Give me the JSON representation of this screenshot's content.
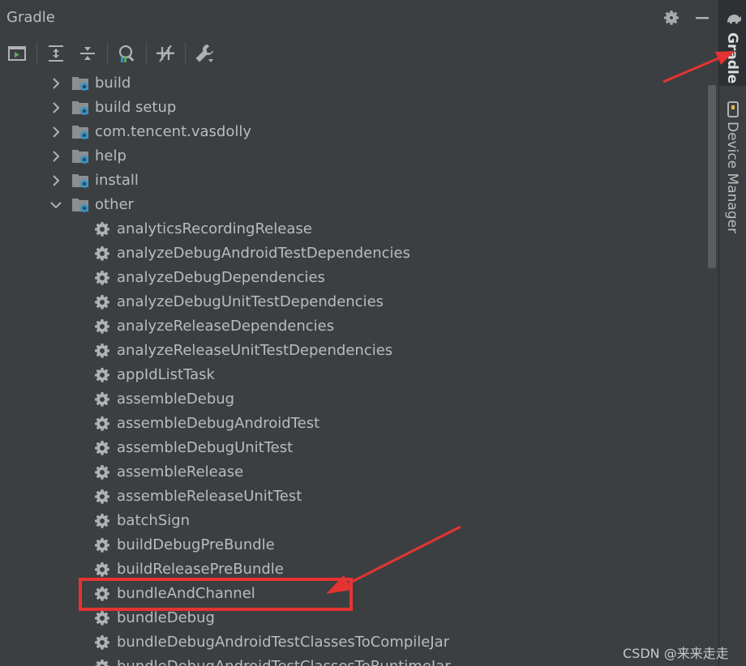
{
  "panel": {
    "title": "Gradle"
  },
  "tree": {
    "groups": [
      {
        "label": "build",
        "expanded": false
      },
      {
        "label": "build setup",
        "expanded": false
      },
      {
        "label": "com.tencent.vasdolly",
        "expanded": false
      },
      {
        "label": "help",
        "expanded": false
      },
      {
        "label": "install",
        "expanded": false
      },
      {
        "label": "other",
        "expanded": true
      }
    ],
    "tasks": [
      "analyticsRecordingRelease",
      "analyzeDebugAndroidTestDependencies",
      "analyzeDebugDependencies",
      "analyzeDebugUnitTestDependencies",
      "analyzeReleaseDependencies",
      "analyzeReleaseUnitTestDependencies",
      "appIdListTask",
      "assembleDebug",
      "assembleDebugAndroidTest",
      "assembleDebugUnitTest",
      "assembleRelease",
      "assembleReleaseUnitTest",
      "batchSign",
      "buildDebugPreBundle",
      "buildReleasePreBundle",
      "bundleAndChannel",
      "bundleDebug",
      "bundleDebugAndroidTestClassesToCompileJar",
      "bundleDebugAndroidTestClassesToRuntimeJar"
    ]
  },
  "right_stripe": {
    "gradle_tab": "Gradle",
    "device_manager_tab": "Device Manager"
  },
  "watermark": "CSDN @来来走走",
  "colors": {
    "background": "#3c3f41",
    "text": "#bbbbbb",
    "folder": "#8a8f93",
    "gear_blue": "#3592c4",
    "annotation_red": "#e53333"
  }
}
